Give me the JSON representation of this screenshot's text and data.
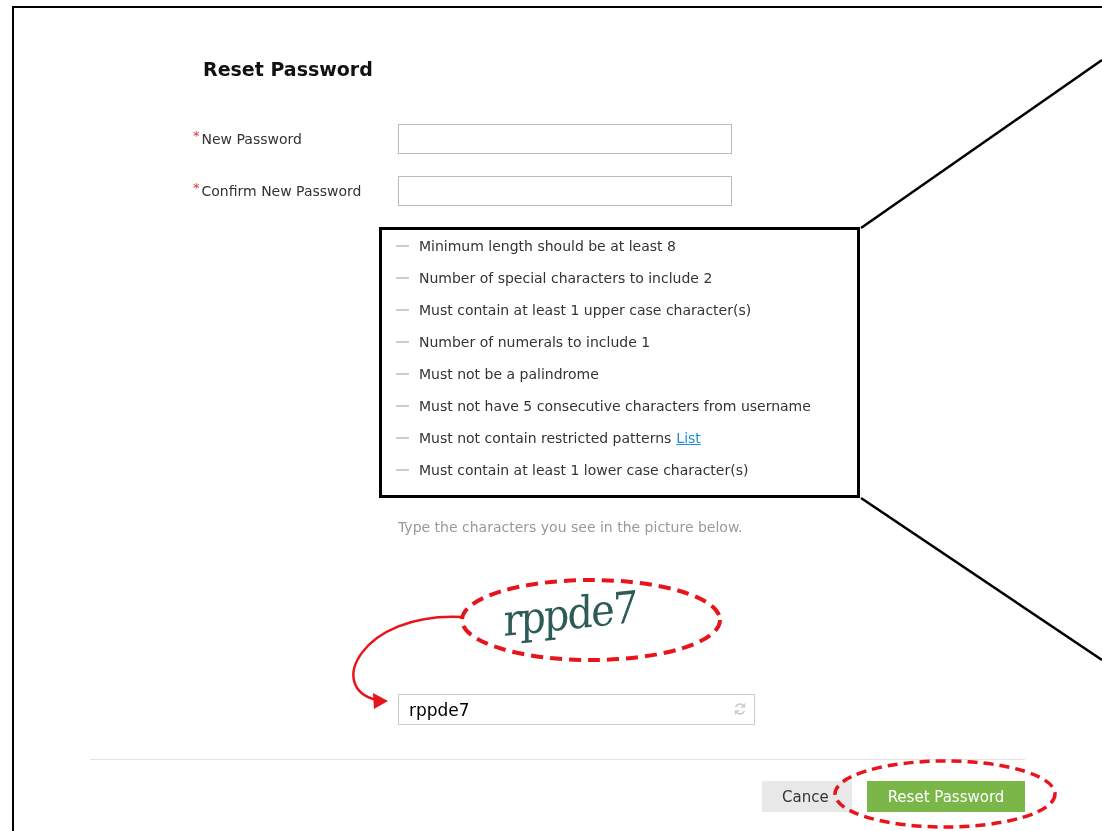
{
  "title": "Reset Password",
  "fields": [
    {
      "marker": "*",
      "label": "New Password"
    },
    {
      "marker": "*",
      "label": "Confirm New Password"
    }
  ],
  "requirements": [
    {
      "text": "Minimum length should be at least 8"
    },
    {
      "text": "Number of special characters to include 2"
    },
    {
      "text": "Must contain at least 1 upper case character(s)"
    },
    {
      "text": "Number of numerals to include 1"
    },
    {
      "text": "Must not be a palindrome"
    },
    {
      "text": "Must not have 5 consecutive characters from username"
    },
    {
      "text": "Must not contain restricted patterns",
      "link": "List"
    },
    {
      "text": "Must contain at least 1 lower case character(s)"
    }
  ],
  "captcha": {
    "hint": "Type the characters you see in the picture below.",
    "text": "rppde7",
    "value": "rppde7"
  },
  "buttons": [
    {
      "label": "Cance",
      "kind": "secondary"
    },
    {
      "label": "Reset Password",
      "kind": "primary"
    }
  ]
}
